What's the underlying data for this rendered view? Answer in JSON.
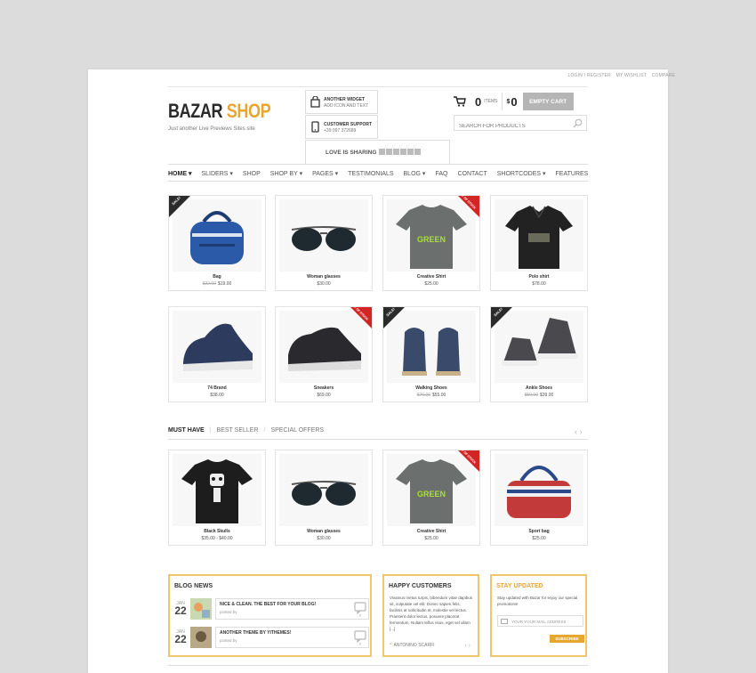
{
  "toplinks": [
    "LOGIN / REGISTER",
    "MY WISHLIST",
    "COMPARE"
  ],
  "logo": {
    "part1": "BAZAR",
    "part2": "SHOP",
    "tagline": "Just another Live Previews Sites site"
  },
  "widgets": [
    {
      "title": "ANOTHER WIDGET",
      "sub": "ADD ICON AND TEXT",
      "icon": "bag-icon"
    },
    {
      "title": "CUSTOMER SUPPORT",
      "sub": "+39 097 372689",
      "icon": "phone-icon"
    }
  ],
  "sharing": {
    "label": "LOVE IS SHARING"
  },
  "cart": {
    "count": "0",
    "items_label": "ITEMS",
    "currency": "$",
    "total": "0",
    "button": "EMPTY CART"
  },
  "search": {
    "placeholder": "SEARCH FOR PRODUCTS"
  },
  "nav": [
    "HOME",
    "SLIDERS",
    "SHOP",
    "SHOP BY",
    "PAGES",
    "TESTIMONIALS",
    "BLOG",
    "FAQ",
    "CONTACT",
    "SHORTCODES",
    "FEATURES"
  ],
  "products_row1": [
    {
      "name": "Bag",
      "old": "$22.00",
      "price": "$19.00",
      "badge": "SALE!"
    },
    {
      "name": "Woman glasses",
      "old": "",
      "price": "$30.00",
      "badge": ""
    },
    {
      "name": "Creative Shirt",
      "old": "",
      "price": "$25.00",
      "badge": "OUT OF STOCK"
    },
    {
      "name": "Polo shirt",
      "old": "",
      "price": "$78.00",
      "badge": ""
    }
  ],
  "products_row2": [
    {
      "name": "74 Brand",
      "old": "",
      "price": "$38.00",
      "badge": ""
    },
    {
      "name": "Sneakers",
      "old": "",
      "price": "$69.00",
      "badge": "OUT OF STOCK"
    },
    {
      "name": "Walking Shoes",
      "old": "$70.00",
      "price": "$55.00",
      "badge": "SALE!"
    },
    {
      "name": "Ankle Shoes",
      "old": "$59.00",
      "price": "$39.00",
      "badge": "SALE!"
    }
  ],
  "tabs": [
    "MUST HAVE",
    "BEST SELLER",
    "SPECIAL OFFERS"
  ],
  "products_row3": [
    {
      "name": "Black Skulls",
      "old": "",
      "price": "$35.00 - $40.00",
      "badge": ""
    },
    {
      "name": "Woman glasses",
      "old": "",
      "price": "$30.00",
      "badge": ""
    },
    {
      "name": "Creative Shirt",
      "old": "",
      "price": "$25.00",
      "badge": "OUT OF STOCK"
    },
    {
      "name": "Sport bag",
      "old": "",
      "price": "$25.00",
      "badge": ""
    }
  ],
  "blog": {
    "title": "BLOG NEWS",
    "posts": [
      {
        "month": "JAN",
        "day": "22",
        "title": "NICE & CLEAN. THE BEST FOR YOUR BLOG!",
        "by": "posted by"
      },
      {
        "month": "JAN",
        "day": "22",
        "title": "ANOTHER THEME BY YITHEMES!",
        "by": "posted by"
      }
    ]
  },
  "customers": {
    "title": "HAPPY CUSTOMERS",
    "text": "Vivamus metus turpis, bibendum vitae dapibus sit, vulputate vel elit. Donec sapien felis, facilisis at sollicitudin et, molestie vel lectus. Praesent dolor lectus, posuere placerat fermentum. Nullam tellus risus, eget vel ullam [...]",
    "author": "ANTONINO SCARFI"
  },
  "newsletter": {
    "title": "STAY UPDATED",
    "text": "Stay updated with Bazar for enjoy our special promotions!",
    "placeholder": "YOUR YOUR MAIL ADDRESS",
    "button": "SUBSCRIBE"
  },
  "colors": {
    "accent": "#e7a630",
    "sale": "#2b2b2b",
    "out": "#d42525"
  }
}
